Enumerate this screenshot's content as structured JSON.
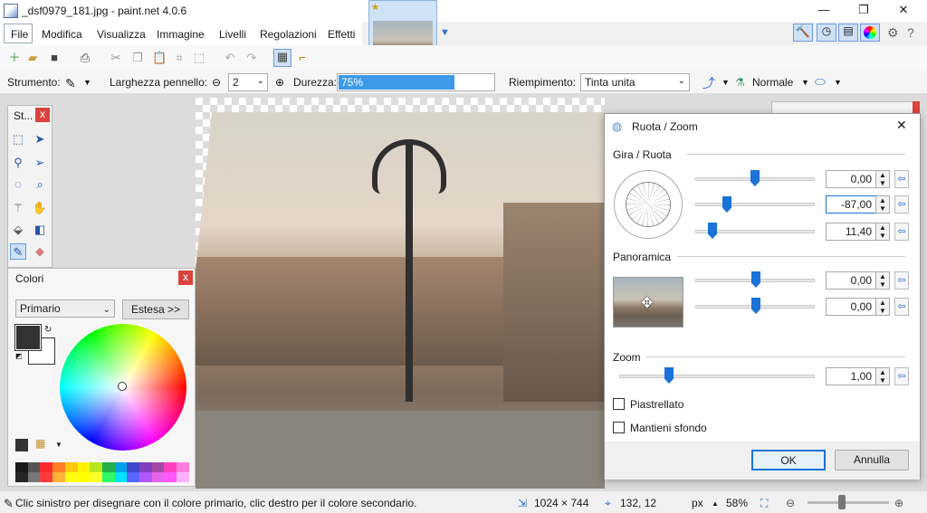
{
  "window": {
    "title": "_dsf0979_181.jpg - paint.net 4.0.6",
    "minimize": "—",
    "maximize": "❐",
    "close": "✕"
  },
  "menu": [
    "File",
    "Modifica",
    "Visualizza",
    "Immagine",
    "Livelli",
    "Regolazioni",
    "Effetti"
  ],
  "toolbar2": {
    "tool_label": "Strumento:",
    "brush_label": "Larghezza pennello:",
    "brush_value": "2",
    "hardness_label": "Durezza:",
    "hardness_value": "75%",
    "hardness_fill": 0.75,
    "fill_label": "Riempimento:",
    "fill_value": "Tinta unita",
    "blend_value": "Normale"
  },
  "tools_window": {
    "title": "St...",
    "close": "x"
  },
  "colors_window": {
    "title": "Colori",
    "close": "x",
    "selector": "Primario",
    "extend_button": "Estesa >>"
  },
  "dialog": {
    "title": "Ruota / Zoom",
    "close": "✕",
    "section_rotate": "Gira / Ruota",
    "rotate_values": [
      "0,00",
      "-87,00",
      "11,40"
    ],
    "section_pan": "Panoramica",
    "pan_values": [
      "0,00",
      "0,00"
    ],
    "section_zoom": "Zoom",
    "zoom_value": "1,00",
    "tiled_label": "Piastrellato",
    "keep_bg_label": "Mantieni sfondo",
    "ok": "OK",
    "cancel": "Annulla"
  },
  "status": {
    "hint": "Clic sinistro per disegnare con il colore primario, clic destro per il colore secondario.",
    "image_size": "1024 × 744",
    "cursor_pos": "132, 12",
    "unit": "px",
    "zoom": "58%"
  },
  "palette": [
    "#1a1a1a",
    "#555555",
    "#ff2a2a",
    "#ff7f27",
    "#ffc90e",
    "#fff200",
    "#b5e61d",
    "#22b14c",
    "#00a2e8",
    "#3f48cc",
    "#7f3fbf",
    "#a349a4",
    "#ff3fbf",
    "#ff7fdf"
  ],
  "colors": {
    "accent": "#1a73d8",
    "primary_color": "#333333",
    "secondary_color": "#ffffff"
  }
}
